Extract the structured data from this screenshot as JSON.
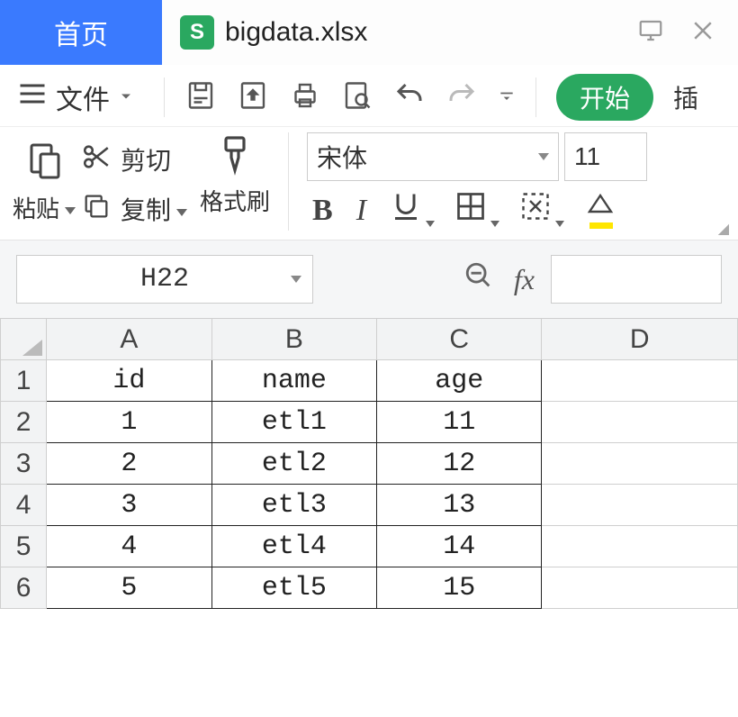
{
  "tabs": {
    "home": "首页",
    "filename": "bigdata.xlsx",
    "file_icon_letter": "S"
  },
  "menubar": {
    "file": "文件",
    "start_pill": "开始",
    "insert": "插"
  },
  "ribbon": {
    "paste": "粘贴",
    "cut": "剪切",
    "copy": "复制",
    "format_painter": "格式刷",
    "font_name": "宋体",
    "font_size": "11",
    "bold": "B",
    "italic": "I"
  },
  "fxbar": {
    "cell_ref": "H22",
    "fx_label": "fx"
  },
  "sheet": {
    "columns": [
      "A",
      "B",
      "C",
      "D"
    ],
    "row_headers": [
      "1",
      "2",
      "3",
      "4",
      "5",
      "6"
    ],
    "data": [
      [
        "id",
        "name",
        "age"
      ],
      [
        "1",
        "etl1",
        "11"
      ],
      [
        "2",
        "etl2",
        "12"
      ],
      [
        "3",
        "etl3",
        "13"
      ],
      [
        "4",
        "etl4",
        "14"
      ],
      [
        "5",
        "etl5",
        "15"
      ]
    ]
  }
}
